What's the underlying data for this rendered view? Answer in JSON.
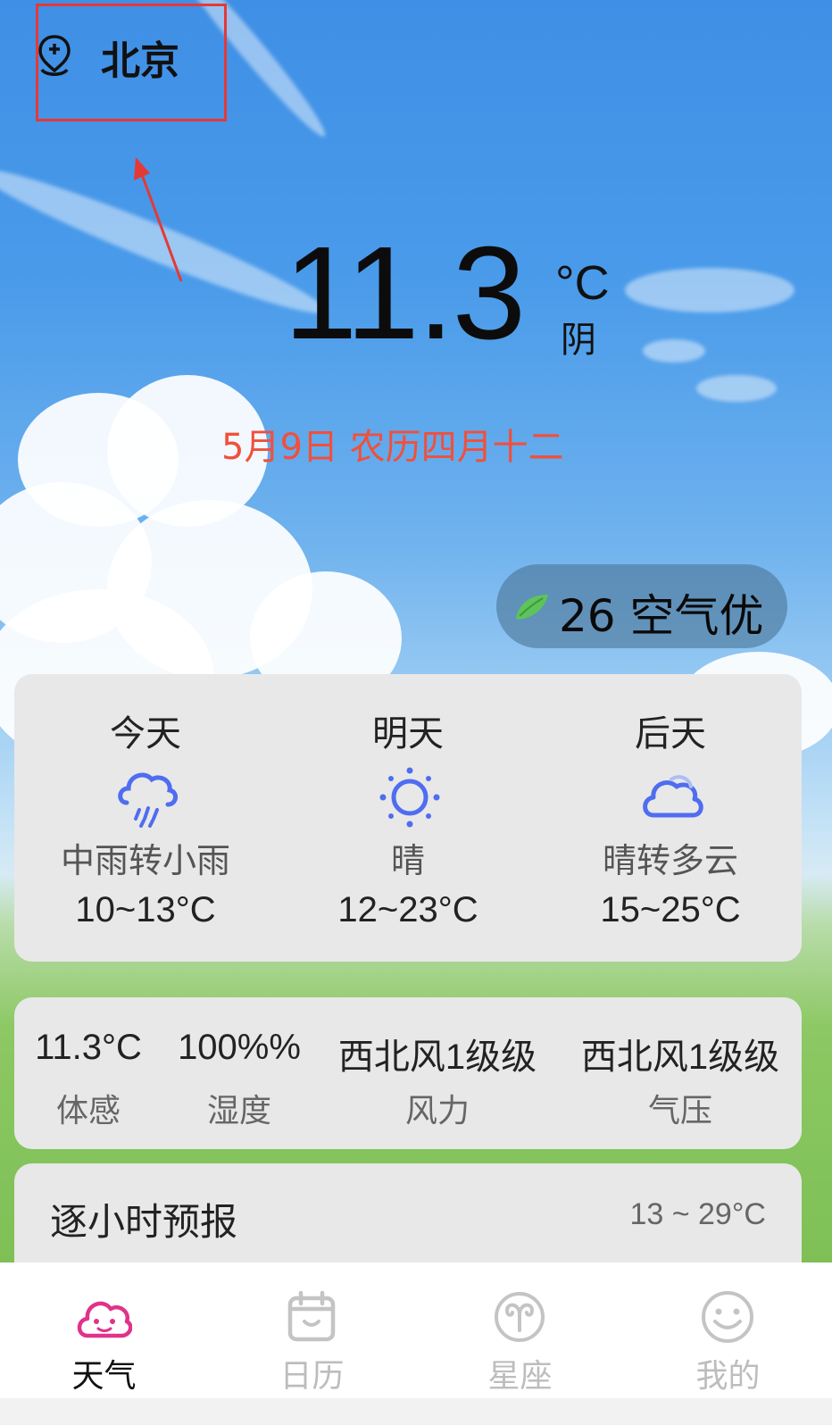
{
  "location": {
    "city": "北京"
  },
  "current": {
    "temperature": "11.3",
    "unit": "°C",
    "condition": "阴",
    "date_lunar": "5月9日 农历四月十二"
  },
  "air_quality": {
    "value": "26 空气优"
  },
  "forecast": [
    {
      "day": "今天",
      "icon": "rain-cloud-icon",
      "desc": "中雨转小雨",
      "range": "10~13°C"
    },
    {
      "day": "明天",
      "icon": "sun-icon",
      "desc": "晴",
      "range": "12~23°C"
    },
    {
      "day": "后天",
      "icon": "cloud-icon",
      "desc": "晴转多云",
      "range": "15~25°C"
    }
  ],
  "details": [
    {
      "value": "11.3°C",
      "label": "体感"
    },
    {
      "value": "100%%",
      "label": "湿度"
    },
    {
      "value": "西北风1级级",
      "label": "风力"
    },
    {
      "value": "西北风1级级",
      "label": "气压"
    }
  ],
  "hourly": {
    "title": "逐小时预报",
    "range": "13 ~ 29°C"
  },
  "tabs": [
    {
      "label": "天气",
      "icon": "smiling-cloud-icon",
      "active": true
    },
    {
      "label": "日历",
      "icon": "calendar-icon",
      "active": false
    },
    {
      "label": "星座",
      "icon": "aries-icon",
      "active": false
    },
    {
      "label": "我的",
      "icon": "smiley-face-icon",
      "active": false
    }
  ],
  "colors": {
    "accent_pink": "#e0338a",
    "date_red": "#f0503c",
    "forecast_icon_blue": "#4f6df0",
    "highlight_red": "#e53935"
  }
}
